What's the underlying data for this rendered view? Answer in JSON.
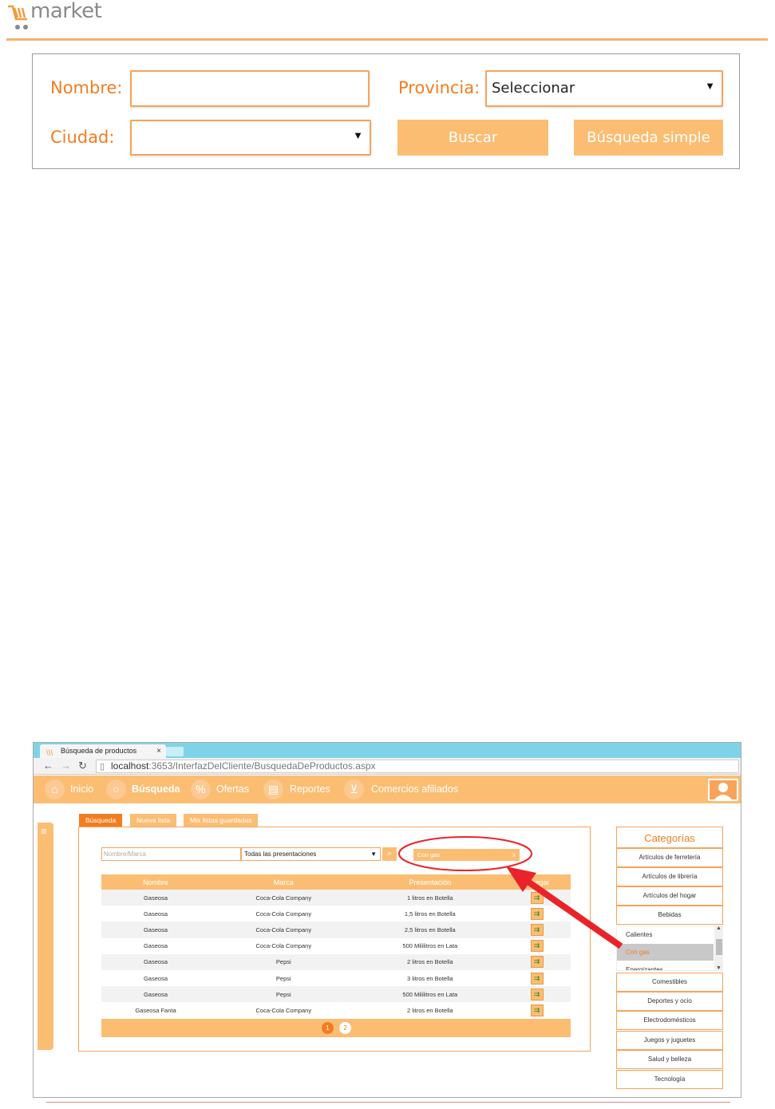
{
  "logo": {
    "text": "market"
  },
  "form": {
    "nombre_label": "Nombre:",
    "nombre_value": "",
    "provincia_label": "Provincia:",
    "provincia_value": "Seleccionar",
    "ciudad_label": "Ciudad:",
    "ciudad_value": "",
    "buscar_label": "Buscar",
    "busqueda_simple_label": "Búsqueda simple"
  },
  "browser": {
    "tab_title": "Búsqueda de productos",
    "tab_close": "×",
    "url_host": "localhost",
    "url_rest": ":3653/InterfazDelCliente/BusquedaDeProductos.aspx"
  },
  "nav": {
    "items": [
      {
        "label": "Inicio",
        "icon": "home-icon"
      },
      {
        "label": "Búsqueda",
        "icon": "search-icon"
      },
      {
        "label": "Ofertas",
        "icon": "percent-icon"
      },
      {
        "label": "Reportes",
        "icon": "clipboard-icon"
      },
      {
        "label": "Comercios afiliados",
        "icon": "cart-icon"
      }
    ]
  },
  "page_tabs": [
    "Búsqueda",
    "Nueva lista",
    "Mis listas guardadas"
  ],
  "search": {
    "placeholder": "Nombre/Marca",
    "presentation_value": "Todas las presentaciones",
    "filter_chip": "Con gas",
    "filter_chip_close": "x"
  },
  "table": {
    "headers": [
      "Nombre",
      "Marca",
      "Presentación",
      "Agregar"
    ],
    "rows": [
      [
        "Gaseosa",
        "Coca-Cola Company",
        "1 litros en Botella"
      ],
      [
        "Gaseosa",
        "Coca-Cola Company",
        "1,5 litros en Botella"
      ],
      [
        "Gaseosa",
        "Coca-Cola Company",
        "2,5 litros en Botella"
      ],
      [
        "Gaseosa",
        "Coca-Cola Company",
        "500 Mililitros en Lata"
      ],
      [
        "Gaseosa",
        "Pepsi",
        "2 litros en Botella"
      ],
      [
        "Gaseosa",
        "Pepsi",
        "3 litros en Botella"
      ],
      [
        "Gaseosa",
        "Pepsi",
        "500 Mililitros en Lata"
      ],
      [
        "Gaseosa Fanta",
        "Coca-Cola Company",
        "2 litros en Botella"
      ]
    ]
  },
  "pager": {
    "pages": [
      "1",
      "2"
    ],
    "current": "1"
  },
  "categories": {
    "title": "Categorías",
    "top": [
      "Artículos de ferretería",
      "Artículos de librería",
      "Artículos del hogar",
      "Bebidas"
    ],
    "sub": [
      "Calientes",
      "Con gas",
      "Energizantes"
    ],
    "bottom": [
      "Comestibles",
      "Deportes y ocio",
      "Electrodomésticos",
      "Juegos y juguetes",
      "Salud y belleza",
      "Tecnología"
    ]
  },
  "colors": {
    "accent": "#fbbd72",
    "accent_dark": "#f47c20",
    "highlight_red": "#e8242a"
  }
}
